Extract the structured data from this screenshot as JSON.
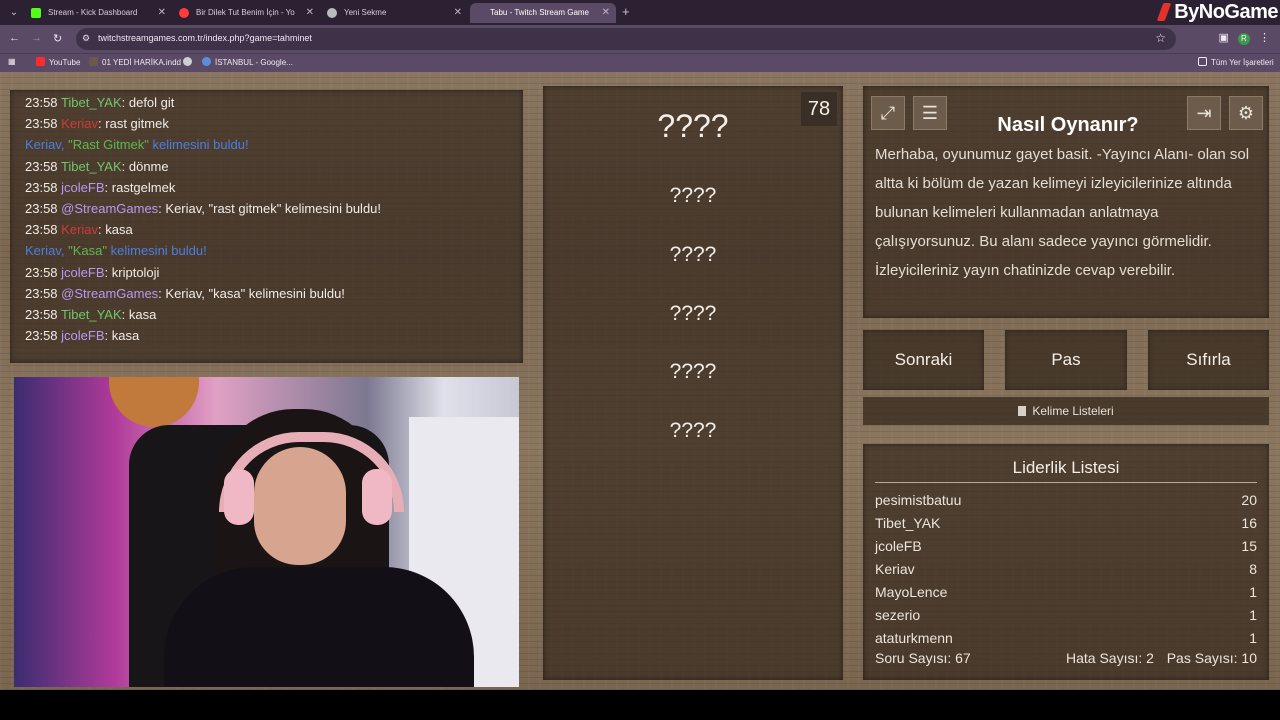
{
  "browser": {
    "tabs": [
      {
        "title": "Stream - Kick Dashboard",
        "fav_color": "#53fc18"
      },
      {
        "title": "Bir Dilek Tut Benim İçin - Yo",
        "fav_color": "#ff3b3b"
      },
      {
        "title": "Yeni Sekme",
        "fav_color": "#bbbbbb"
      },
      {
        "title": "Tabu - Twitch Stream Game",
        "fav_color": "#7a4ac0"
      }
    ],
    "url": "twitchstreamgames.com.tr/index.php?game=tahminet",
    "bookmarks": [
      {
        "label": "YouTube",
        "color": "#ff2a2a"
      },
      {
        "label": "01 YEDİ HARİKA.indd",
        "color": "#6b5a4b"
      },
      {
        "label": "",
        "color": "#cfcfcf"
      },
      {
        "label": "İSTANBUL - Google...",
        "color": "#5b8fd9"
      }
    ],
    "all_bookmarks": "Tüm Yer İşaretleri",
    "profile_letter": "R"
  },
  "brand": "ByNoGame",
  "chat": [
    {
      "time": "23:58",
      "user": "Tibet_YAK",
      "msg": ": defol git",
      "kind": "green"
    },
    {
      "time": "23:58",
      "user": "Keriav",
      "msg": ": rast gitmek",
      "kind": "red"
    },
    {
      "user": "Keriav",
      "quoted": "\"Rast Gitmek\"",
      "msg": " kelimesini buldu!",
      "kind": "found"
    },
    {
      "time": "23:58",
      "user": "Tibet_YAK",
      "msg": ": dönme",
      "kind": "green"
    },
    {
      "time": "23:58",
      "user": "jcoleFB",
      "msg": ": rastgelmek",
      "kind": "purple"
    },
    {
      "time": "23:58",
      "user": "@StreamGames",
      "msg": ": Keriav, \"rast gitmek\" kelimesini buldu!",
      "kind": "purple"
    },
    {
      "time": "23:58",
      "user": "Keriav",
      "msg": ": kasa",
      "kind": "red"
    },
    {
      "user": "Keriav",
      "quoted": "\"Kasa\"",
      "msg": " kelimesini buldu!",
      "kind": "found"
    },
    {
      "time": "23:58",
      "user": "jcoleFB",
      "msg": ": kriptoloji",
      "kind": "purple"
    },
    {
      "time": "23:58",
      "user": "@StreamGames",
      "msg": ": Keriav, \"kasa\" kelimesini buldu!",
      "kind": "purple"
    },
    {
      "time": "23:58",
      "user": "Tibet_YAK",
      "msg": ": kasa",
      "kind": "green"
    },
    {
      "time": "23:58",
      "user": "jcoleFB",
      "msg": ": kasa",
      "kind": "purple"
    }
  ],
  "game": {
    "counter": "78",
    "hidden_words": [
      "????",
      "????",
      "????",
      "????",
      "????",
      "????"
    ]
  },
  "howto": {
    "title": "Nasıl Oynanır?",
    "text": "Merhaba, oyunumuz gayet basit. -Yayıncı Alanı- olan sol altta ki bölüm de yazan kelimeyi izleyicilerinize altında bulunan kelimeleri kullanmadan anlatmaya çalışıyorsunuz. Bu alanı sadece yayıncı görmelidir. İzleyicileriniz yayın chatinizde cevap verebilir."
  },
  "buttons": {
    "next": "Sonraki",
    "pass": "Pas",
    "reset": "Sıfırla",
    "word_lists": "Kelime Listeleri"
  },
  "leaderboard": {
    "title": "Liderlik Listesi",
    "rows": [
      {
        "name": "pesimistbatuu",
        "score": "20"
      },
      {
        "name": "Tibet_YAK",
        "score": "16"
      },
      {
        "name": "jcoleFB",
        "score": "15"
      },
      {
        "name": "Keriav",
        "score": "8"
      },
      {
        "name": "MayoLence",
        "score": "1"
      },
      {
        "name": "sezerio",
        "score": "1"
      },
      {
        "name": "ataturkmenn",
        "score": "1"
      }
    ]
  },
  "stats": {
    "questions": "Soru Sayısı: 67",
    "errors": "Hata Sayısı: 2",
    "passes": "Pas Sayısı: 10"
  }
}
